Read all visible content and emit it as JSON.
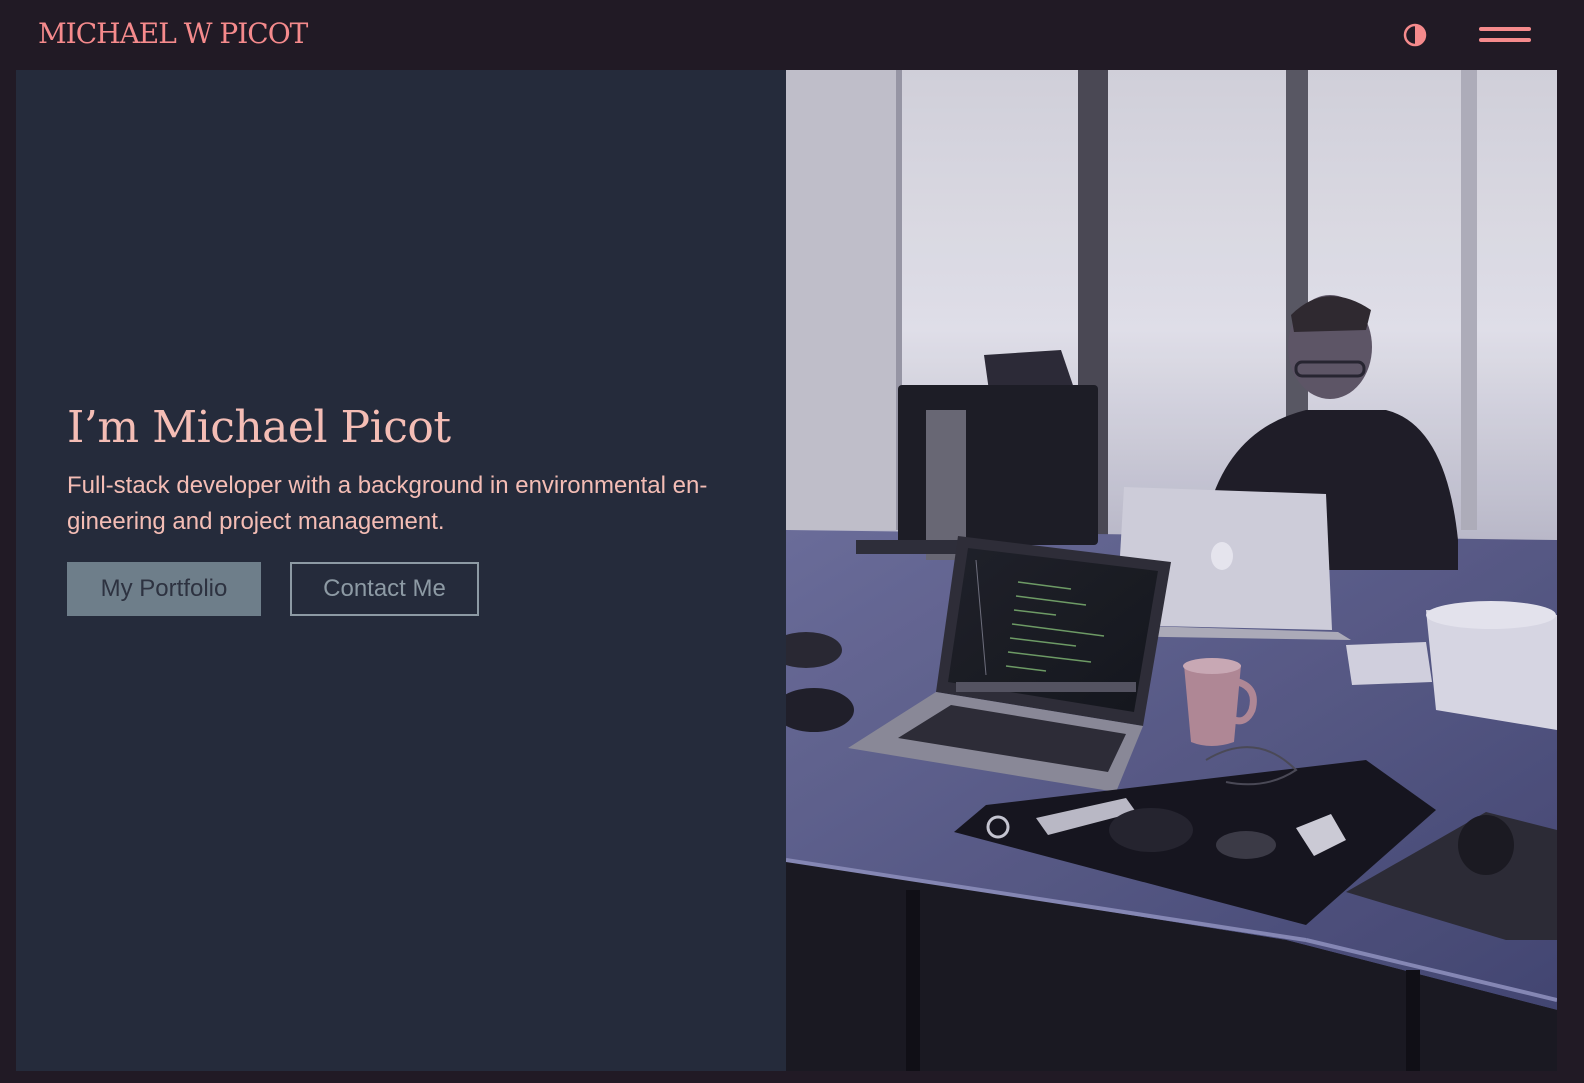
{
  "header": {
    "brand": "MICHAEL W PICOT",
    "theme_toggle_icon": "contrast-half-circle-icon",
    "menu_icon": "hamburger-menu-icon"
  },
  "hero": {
    "headline": "I’m Michael Picot",
    "subtitle": "Full-stack developer with a background in environmental en-gineering and project management.",
    "primary_button": "My Portfolio",
    "secondary_button": "Contact Me",
    "photo_description_icon": "office-desk-laptops-photo"
  },
  "colors": {
    "accent": "#f58a8c",
    "text": "#f4bdb5",
    "header_bg": "#211a25",
    "panel_bg": "#252b3b",
    "button_fill": "#6e7e8a"
  }
}
